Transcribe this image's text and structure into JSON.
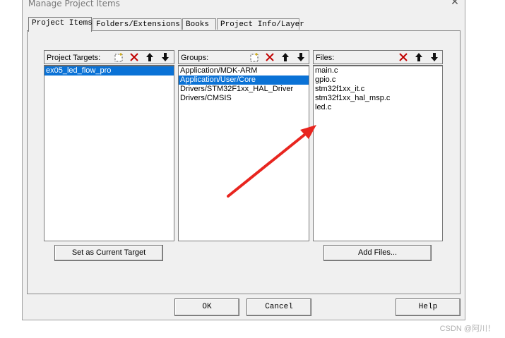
{
  "window": {
    "title": "Manage Project Items"
  },
  "tabs": [
    {
      "label": "Project Items"
    },
    {
      "label": "Folders/Extensions"
    },
    {
      "label": "Books"
    },
    {
      "label": "Project Info/Layer"
    }
  ],
  "targets": {
    "label": "Project Targets:",
    "items": [
      "ex05_led_flow_pro"
    ]
  },
  "groups": {
    "label": "Groups:",
    "items": [
      "Application/MDK-ARM",
      "Application/User/Core",
      "Drivers/STM32F1xx_HAL_Driver",
      "Drivers/CMSIS"
    ]
  },
  "files": {
    "label": "Files:",
    "items": [
      "main.c",
      "gpio.c",
      "stm32f1xx_it.c",
      "stm32f1xx_hal_msp.c",
      "led.c"
    ]
  },
  "buttons": {
    "set_target": "Set as Current Target",
    "add_files": "Add Files...",
    "ok": "OK",
    "cancel": "Cancel",
    "help": "Help"
  },
  "watermark": "CSDN @阿川！",
  "colors": {
    "selection": "#0a72d6",
    "delete_red": "#c00000",
    "annotation_arrow": "#e8251f"
  }
}
